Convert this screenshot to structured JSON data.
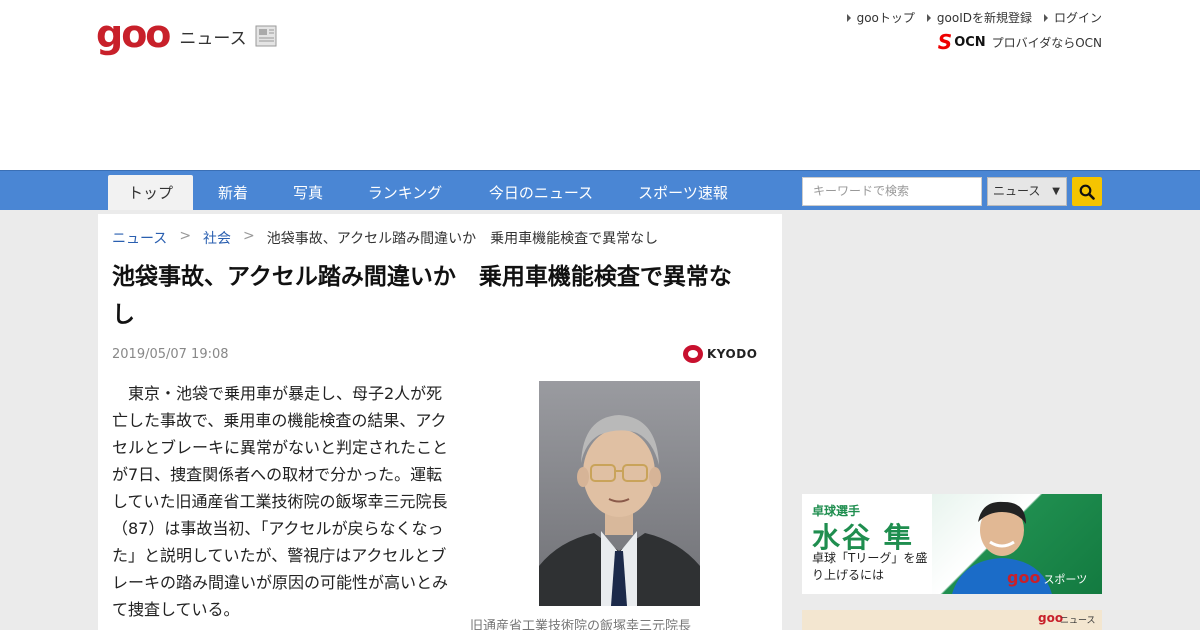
{
  "header": {
    "logo_text": "goo",
    "logo_sub": "ニュース",
    "links": [
      "gooトップ",
      "gooIDを新規登録",
      "ログイン"
    ],
    "ocn_logo": "OCN",
    "ocn_text": "プロバイダならOCN"
  },
  "nav": {
    "items": [
      "トップ",
      "新着",
      "写真",
      "ランキング",
      "今日のニュース",
      "スポーツ速報"
    ],
    "search_placeholder": "キーワードで検索",
    "search_scope": "ニュース"
  },
  "article": {
    "breadcrumb": [
      "ニュース",
      "社会",
      "池袋事故、アクセル踏み間違いか　乗用車機能検査で異常なし"
    ],
    "title": "池袋事故、アクセル踏み間違いか　乗用車機能検査で異常なし",
    "date": "2019/05/07 19:08",
    "source": "KYODO",
    "body": "　東京・池袋で乗用車が暴走し、母子2人が死亡した事故で、乗用車の機能検査の結果、アクセルとブレーキに異常がないと判定されたことが7日、捜査関係者への取材で分かった。運転していた旧通産省工業技術院の飯塚幸三元院長（87）は事故当初、「アクセルが戻らなくなった」と説明していたが、警視庁はアクセルとブレーキの踏み間違いが原因の可能性が高いとみて捜査している。",
    "photo_caption": "旧通産省工業技術院の飯塚幸三元院長"
  },
  "sidebar": {
    "ad1": {
      "line1": "卓球選手",
      "line2": "水谷 隼",
      "line3": "卓球「Tリーグ」を盛り上げるには",
      "badge_logo": "goo",
      "badge_text": "スポーツ"
    },
    "ad2": {
      "badge_logo": "goo",
      "badge_text": "ニュース"
    }
  },
  "colors": {
    "brand_red": "#c8202a",
    "nav_blue": "#4a86d4",
    "link_blue": "#2a5fb0",
    "search_yellow": "#f5c400",
    "sport_green": "#1f8e4f"
  }
}
